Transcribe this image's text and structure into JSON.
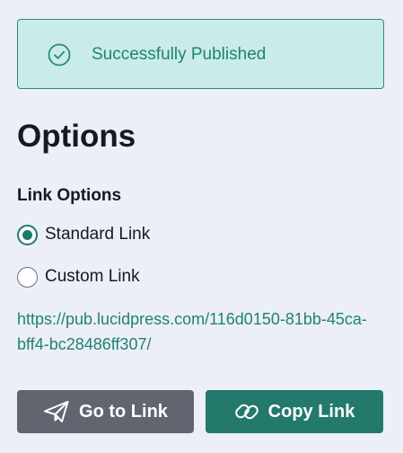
{
  "alert": {
    "message": "Successfully Published",
    "icon": "check-circle-icon",
    "background": "#c9ece8",
    "border": "#2a8a7c",
    "text_color": "#1e8472"
  },
  "options": {
    "title": "Options",
    "link_options_label": "Link Options",
    "radios": [
      {
        "label": "Standard Link",
        "checked": true
      },
      {
        "label": "Custom Link",
        "checked": false
      }
    ],
    "url": "https://pub.lucidpress.com/116d0150-81bb-45ca-bff4-bc28486ff307/"
  },
  "buttons": {
    "go_to_link": {
      "label": "Go to Link",
      "icon": "paper-plane-icon",
      "color": "#606570"
    },
    "copy_link": {
      "label": "Copy Link",
      "icon": "link-icon",
      "color": "#237a6c"
    }
  },
  "colors": {
    "page_background": "#eceef8",
    "accent": "#1f7a6c",
    "text": "#141a22"
  }
}
